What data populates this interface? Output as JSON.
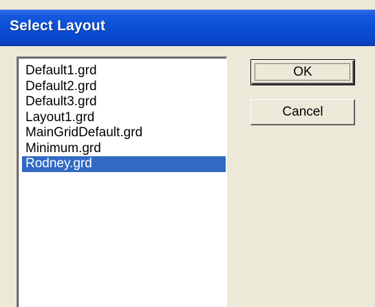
{
  "dialog": {
    "title": "Select Layout"
  },
  "layout_list": {
    "items": [
      {
        "label": "Default1.grd",
        "selected": false
      },
      {
        "label": "Default2.grd",
        "selected": false
      },
      {
        "label": "Default3.grd",
        "selected": false
      },
      {
        "label": "Layout1.grd",
        "selected": false
      },
      {
        "label": "MainGridDefault.grd",
        "selected": false
      },
      {
        "label": "Minimum.grd",
        "selected": false
      },
      {
        "label": "Rodney.grd",
        "selected": true
      }
    ]
  },
  "buttons": {
    "ok_label": "OK",
    "cancel_label": "Cancel"
  },
  "colors": {
    "titlebar": "#0a4fd6",
    "selection": "#316ac5",
    "dialog_face": "#ece9d8"
  }
}
